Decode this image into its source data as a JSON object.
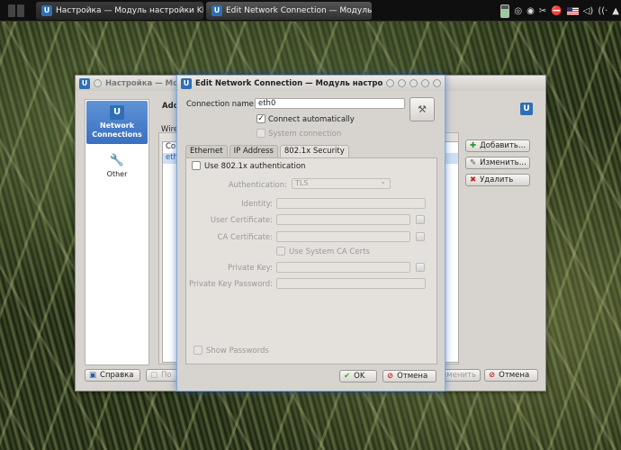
{
  "taskbar": {
    "task1": "Настройка — Модуль настройки KDE",
    "task2": "Edit Network Connection — Модуль нас"
  },
  "main_window": {
    "title": "Настройка — Модуль",
    "header_title": "Add",
    "tab_label": "Wire",
    "list_header": "Co",
    "list_row": "eth",
    "sidebar": [
      {
        "label": "Network Connections",
        "icon": "network-icon"
      },
      {
        "label": "Other",
        "icon": "tools-icon"
      }
    ],
    "buttons": {
      "add": "Добавить...",
      "edit": "Изменить...",
      "delete": "Удалить"
    },
    "bottom": {
      "help": "Справка",
      "defaults": "По",
      "apply": "Применить",
      "cancel": "Отмена"
    }
  },
  "dialog": {
    "title": "Edit Network Connection — Модуль настрой...",
    "connection_name_label": "Connection name:",
    "connection_name_value": "eth0",
    "connect_automatically": "Connect automatically",
    "system_connection": "System connection",
    "tabs": [
      "Ethernet",
      "IP Address",
      "802.1x Security"
    ],
    "use_8021x": "Use 802.1x authentication",
    "authentication_label": "Authentication:",
    "authentication_value": "TLS",
    "identity_label": "Identity:",
    "user_cert_label": "User Certificate:",
    "ca_cert_label": "CA Certificate:",
    "use_system_ca": "Use System CA Certs",
    "private_key_label": "Private Key:",
    "private_key_password_label": "Private Key Password:",
    "show_passwords": "Show Passwords",
    "ok": "OK",
    "cancel": "Отмена"
  }
}
